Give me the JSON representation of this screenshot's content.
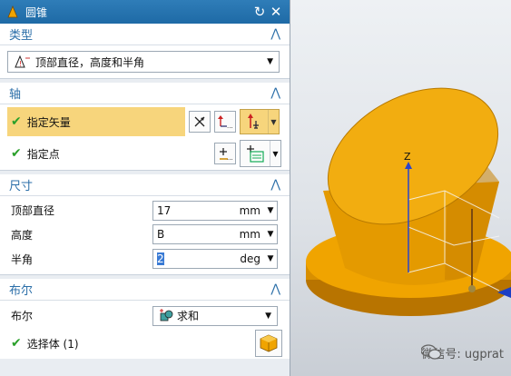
{
  "dialog": {
    "title": "圆锥",
    "colors": {
      "titlebar": "#1e6aa6",
      "accent": "#2a6ea8",
      "highlight": "#f7d57c",
      "check": "#2aa02a"
    },
    "groups": {
      "type": {
        "header": "类型",
        "selected": "顶部直径，高度和半角"
      },
      "axis": {
        "header": "轴",
        "vector_label": "指定矢量",
        "point_label": "指定点"
      },
      "dims": {
        "header": "尺寸",
        "fields": [
          {
            "label": "顶部直径",
            "value": "17",
            "unit": "mm"
          },
          {
            "label": "高度",
            "value": "B",
            "unit": "mm"
          },
          {
            "label": "半角",
            "value": "2",
            "unit": "deg"
          }
        ]
      },
      "boolean": {
        "header": "布尔",
        "label": "布尔",
        "selected": "求和",
        "select_body_label": "选择体 (1)"
      }
    }
  },
  "viewport": {
    "axis_label": "Z",
    "watermark": "微信号: ugprat",
    "colors": {
      "cone": "#f0a400",
      "cone_dark": "#c98200",
      "base": "#e09a00"
    }
  }
}
